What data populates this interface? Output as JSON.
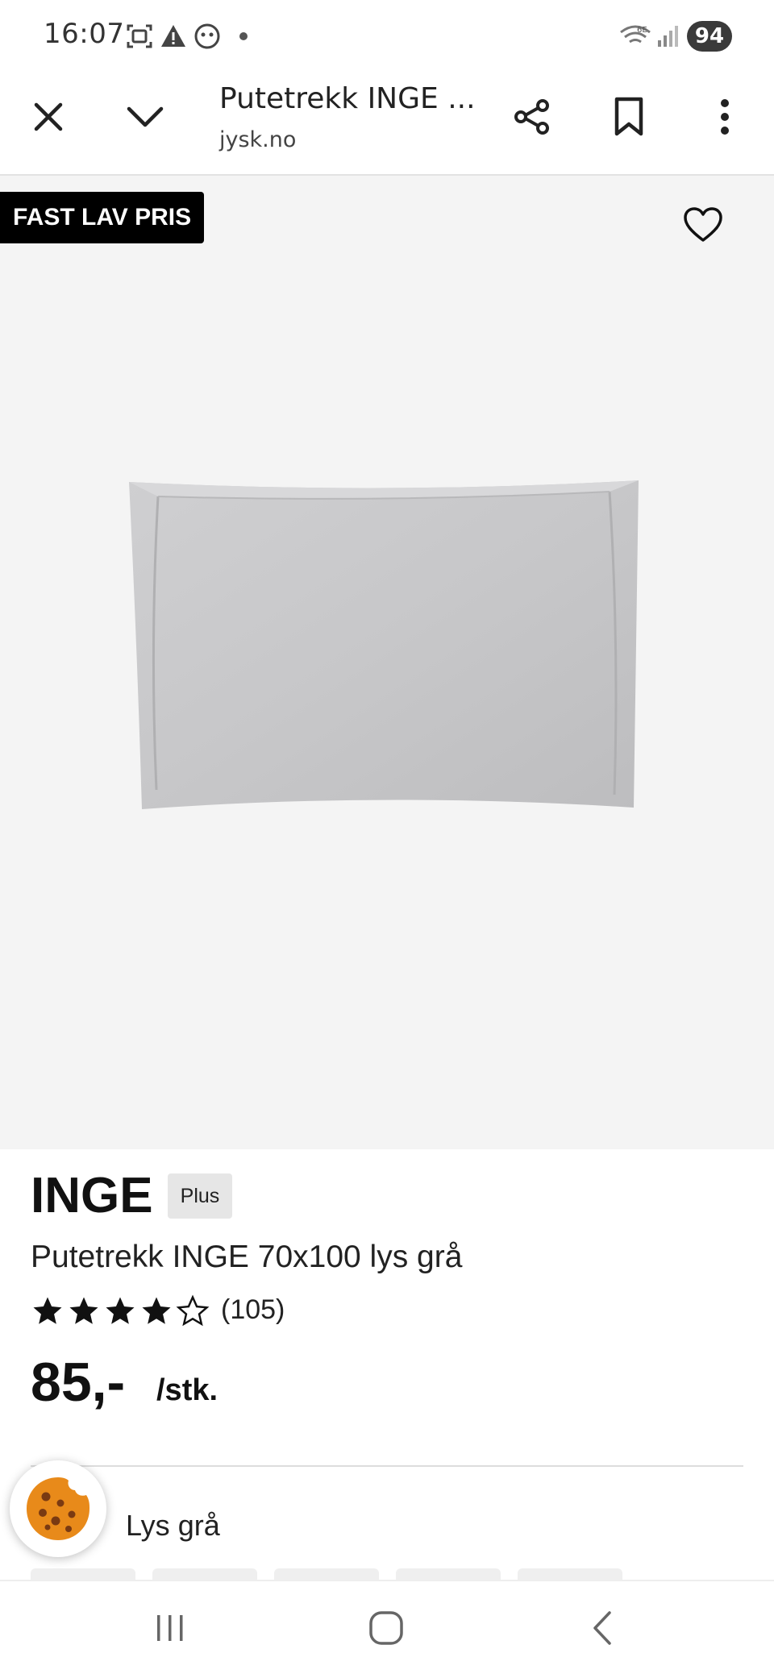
{
  "status_bar": {
    "time": "16:07",
    "battery": "94",
    "icons": [
      "screenshot-icon",
      "warning-icon",
      "face-icon",
      "dot-icon",
      "wifi-6e-icon",
      "signal-icon"
    ]
  },
  "toolbar": {
    "title": "Putetrekk INGE ...",
    "url": "jysk.no",
    "icons": [
      "close-icon",
      "chevron-down-icon",
      "share-icon",
      "bookmark-icon",
      "more-vert-icon"
    ]
  },
  "product": {
    "badge": "FAST LAV PRIS",
    "brand": "INGE",
    "plus_label": "Plus",
    "name": "Putetrekk INGE 70x100 lys grå",
    "rating": 4,
    "rating_max": 5,
    "review_count": "(105)",
    "price": "85,-",
    "unit": "/stk.",
    "color_label": "e:",
    "color_value": "Lys grå"
  },
  "colors": {
    "hero_bg": "#f4f4f4",
    "badge_bg": "#000000",
    "pillow": "#c8c8ca",
    "cookie": "#e88a1a"
  }
}
